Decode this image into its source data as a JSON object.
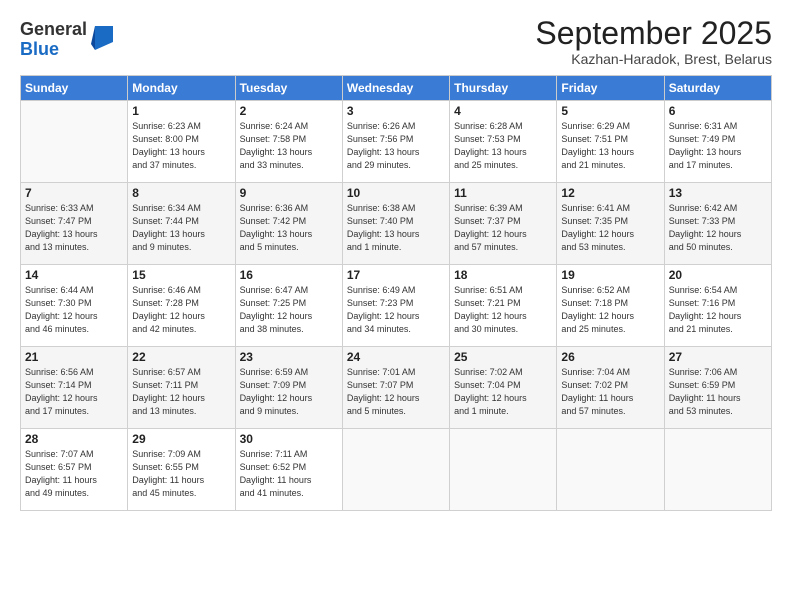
{
  "logo": {
    "general": "General",
    "blue": "Blue"
  },
  "header": {
    "month": "September 2025",
    "location": "Kazhan-Haradok, Brest, Belarus"
  },
  "weekdays": [
    "Sunday",
    "Monday",
    "Tuesday",
    "Wednesday",
    "Thursday",
    "Friday",
    "Saturday"
  ],
  "weeks": [
    [
      {
        "day": "",
        "info": ""
      },
      {
        "day": "1",
        "info": "Sunrise: 6:23 AM\nSunset: 8:00 PM\nDaylight: 13 hours\nand 37 minutes."
      },
      {
        "day": "2",
        "info": "Sunrise: 6:24 AM\nSunset: 7:58 PM\nDaylight: 13 hours\nand 33 minutes."
      },
      {
        "day": "3",
        "info": "Sunrise: 6:26 AM\nSunset: 7:56 PM\nDaylight: 13 hours\nand 29 minutes."
      },
      {
        "day": "4",
        "info": "Sunrise: 6:28 AM\nSunset: 7:53 PM\nDaylight: 13 hours\nand 25 minutes."
      },
      {
        "day": "5",
        "info": "Sunrise: 6:29 AM\nSunset: 7:51 PM\nDaylight: 13 hours\nand 21 minutes."
      },
      {
        "day": "6",
        "info": "Sunrise: 6:31 AM\nSunset: 7:49 PM\nDaylight: 13 hours\nand 17 minutes."
      }
    ],
    [
      {
        "day": "7",
        "info": "Sunrise: 6:33 AM\nSunset: 7:47 PM\nDaylight: 13 hours\nand 13 minutes."
      },
      {
        "day": "8",
        "info": "Sunrise: 6:34 AM\nSunset: 7:44 PM\nDaylight: 13 hours\nand 9 minutes."
      },
      {
        "day": "9",
        "info": "Sunrise: 6:36 AM\nSunset: 7:42 PM\nDaylight: 13 hours\nand 5 minutes."
      },
      {
        "day": "10",
        "info": "Sunrise: 6:38 AM\nSunset: 7:40 PM\nDaylight: 13 hours\nand 1 minute."
      },
      {
        "day": "11",
        "info": "Sunrise: 6:39 AM\nSunset: 7:37 PM\nDaylight: 12 hours\nand 57 minutes."
      },
      {
        "day": "12",
        "info": "Sunrise: 6:41 AM\nSunset: 7:35 PM\nDaylight: 12 hours\nand 53 minutes."
      },
      {
        "day": "13",
        "info": "Sunrise: 6:42 AM\nSunset: 7:33 PM\nDaylight: 12 hours\nand 50 minutes."
      }
    ],
    [
      {
        "day": "14",
        "info": "Sunrise: 6:44 AM\nSunset: 7:30 PM\nDaylight: 12 hours\nand 46 minutes."
      },
      {
        "day": "15",
        "info": "Sunrise: 6:46 AM\nSunset: 7:28 PM\nDaylight: 12 hours\nand 42 minutes."
      },
      {
        "day": "16",
        "info": "Sunrise: 6:47 AM\nSunset: 7:25 PM\nDaylight: 12 hours\nand 38 minutes."
      },
      {
        "day": "17",
        "info": "Sunrise: 6:49 AM\nSunset: 7:23 PM\nDaylight: 12 hours\nand 34 minutes."
      },
      {
        "day": "18",
        "info": "Sunrise: 6:51 AM\nSunset: 7:21 PM\nDaylight: 12 hours\nand 30 minutes."
      },
      {
        "day": "19",
        "info": "Sunrise: 6:52 AM\nSunset: 7:18 PM\nDaylight: 12 hours\nand 25 minutes."
      },
      {
        "day": "20",
        "info": "Sunrise: 6:54 AM\nSunset: 7:16 PM\nDaylight: 12 hours\nand 21 minutes."
      }
    ],
    [
      {
        "day": "21",
        "info": "Sunrise: 6:56 AM\nSunset: 7:14 PM\nDaylight: 12 hours\nand 17 minutes."
      },
      {
        "day": "22",
        "info": "Sunrise: 6:57 AM\nSunset: 7:11 PM\nDaylight: 12 hours\nand 13 minutes."
      },
      {
        "day": "23",
        "info": "Sunrise: 6:59 AM\nSunset: 7:09 PM\nDaylight: 12 hours\nand 9 minutes."
      },
      {
        "day": "24",
        "info": "Sunrise: 7:01 AM\nSunset: 7:07 PM\nDaylight: 12 hours\nand 5 minutes."
      },
      {
        "day": "25",
        "info": "Sunrise: 7:02 AM\nSunset: 7:04 PM\nDaylight: 12 hours\nand 1 minute."
      },
      {
        "day": "26",
        "info": "Sunrise: 7:04 AM\nSunset: 7:02 PM\nDaylight: 11 hours\nand 57 minutes."
      },
      {
        "day": "27",
        "info": "Sunrise: 7:06 AM\nSunset: 6:59 PM\nDaylight: 11 hours\nand 53 minutes."
      }
    ],
    [
      {
        "day": "28",
        "info": "Sunrise: 7:07 AM\nSunset: 6:57 PM\nDaylight: 11 hours\nand 49 minutes."
      },
      {
        "day": "29",
        "info": "Sunrise: 7:09 AM\nSunset: 6:55 PM\nDaylight: 11 hours\nand 45 minutes."
      },
      {
        "day": "30",
        "info": "Sunrise: 7:11 AM\nSunset: 6:52 PM\nDaylight: 11 hours\nand 41 minutes."
      },
      {
        "day": "",
        "info": ""
      },
      {
        "day": "",
        "info": ""
      },
      {
        "day": "",
        "info": ""
      },
      {
        "day": "",
        "info": ""
      }
    ]
  ]
}
